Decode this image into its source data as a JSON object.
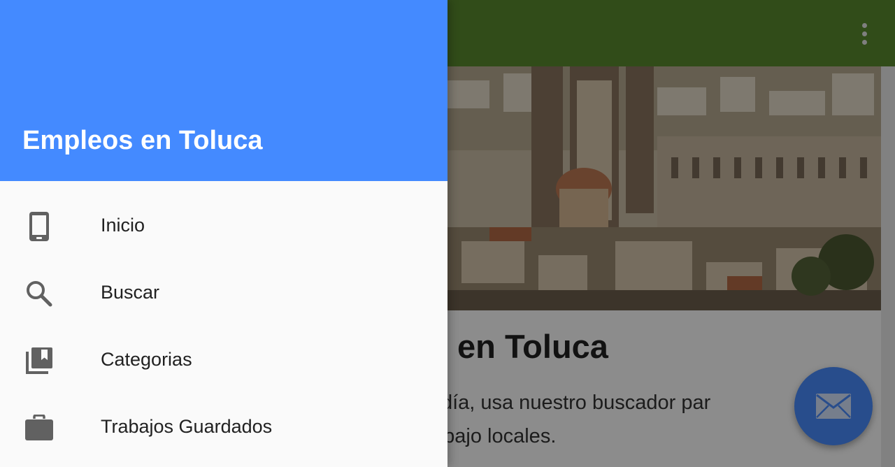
{
  "app": {
    "content_title": "eos en Toluca",
    "content_lines": [
      "cada día, usa nuestro buscador par",
      "de trabajo locales."
    ]
  },
  "drawer": {
    "title": "Empleos en Toluca",
    "items": [
      {
        "label": "Inicio",
        "icon": "smartphone-icon"
      },
      {
        "label": "Buscar",
        "icon": "search-icon"
      },
      {
        "label": "Categorias",
        "icon": "library-books-icon"
      },
      {
        "label": "Trabajos Guardados",
        "icon": "briefcase-icon"
      }
    ]
  },
  "colors": {
    "drawer_header": "#448aff",
    "appbar": "#5a8a2f",
    "fab": "#4a8cff",
    "icon_gray": "#616161"
  }
}
